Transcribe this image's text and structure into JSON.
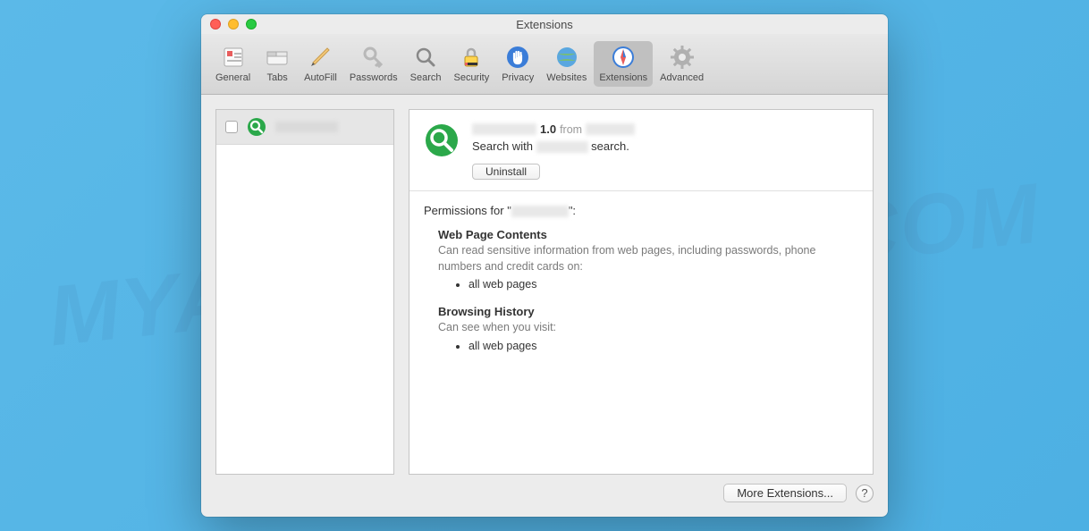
{
  "watermark": "MYANTISPYWARE.COM",
  "window": {
    "title": "Extensions"
  },
  "toolbar": {
    "items": [
      {
        "label": "General"
      },
      {
        "label": "Tabs"
      },
      {
        "label": "AutoFill"
      },
      {
        "label": "Passwords"
      },
      {
        "label": "Search"
      },
      {
        "label": "Security"
      },
      {
        "label": "Privacy"
      },
      {
        "label": "Websites"
      },
      {
        "label": "Extensions"
      },
      {
        "label": "Advanced"
      }
    ]
  },
  "sidebar": {
    "items": [
      {
        "name_redacted": true
      }
    ]
  },
  "detail": {
    "version": "1.0",
    "from_label": "from",
    "desc_prefix": "Search with",
    "desc_suffix": "search.",
    "uninstall_label": "Uninstall"
  },
  "permissions": {
    "label_prefix": "Permissions for \"",
    "label_suffix": "\":",
    "sections": [
      {
        "heading": "Web Page Contents",
        "desc": "Can read sensitive information from web pages, including passwords, phone numbers and credit cards on:",
        "items": [
          "all web pages"
        ]
      },
      {
        "heading": "Browsing History",
        "desc": "Can see when you visit:",
        "items": [
          "all web pages"
        ]
      }
    ]
  },
  "footer": {
    "more_label": "More Extensions...",
    "help_label": "?"
  }
}
